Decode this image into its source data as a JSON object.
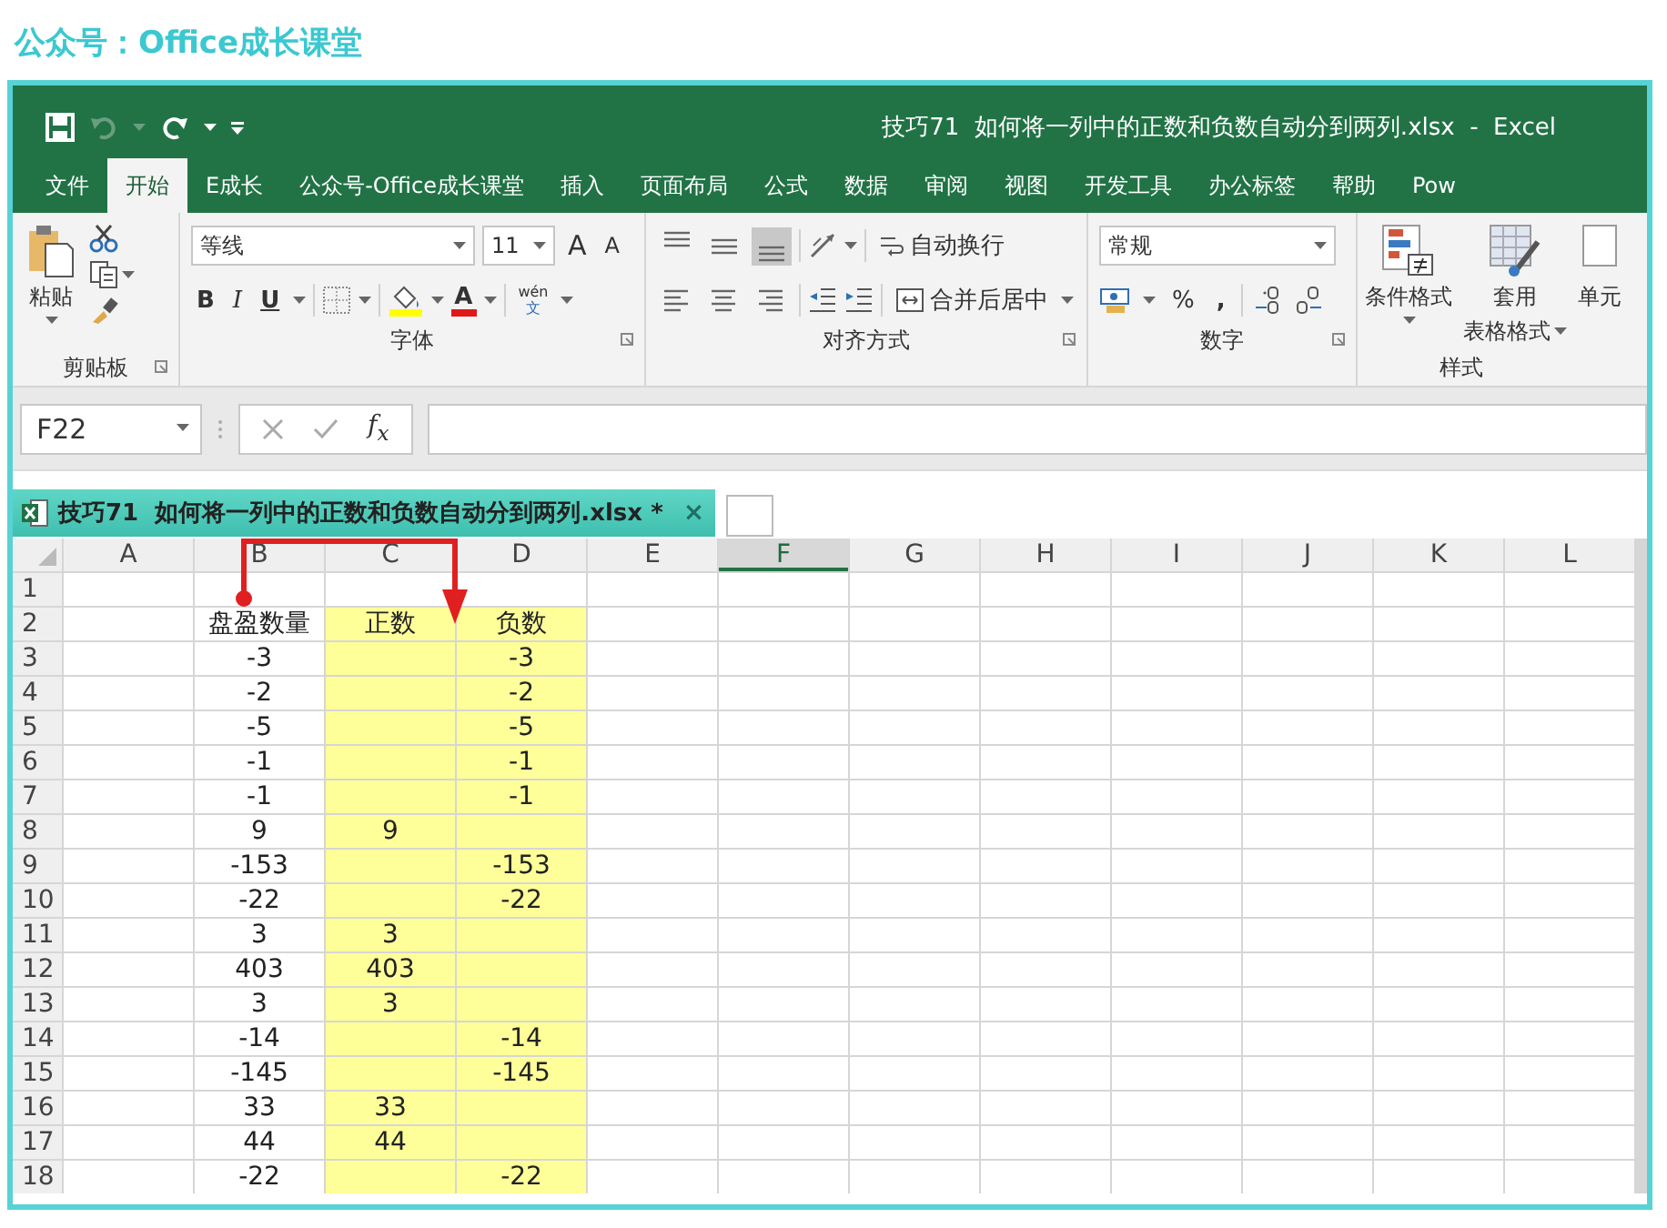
{
  "caption": "公众号：Office成长课堂",
  "window": {
    "title": "技巧71  如何将一列中的正数和负数自动分到两列.xlsx  -  Excel",
    "quick_access": [
      {
        "kind": "save",
        "disabled": false
      },
      {
        "kind": "undo",
        "disabled": true
      },
      {
        "kind": "redo",
        "disabled": false
      },
      {
        "kind": "customize",
        "disabled": false
      }
    ]
  },
  "ribbon_tabs": [
    {
      "label": "文件",
      "selected": false
    },
    {
      "label": "开始",
      "selected": true
    },
    {
      "label": "E成长",
      "selected": false
    },
    {
      "label": "公众号-Office成长课堂",
      "selected": false
    },
    {
      "label": "插入",
      "selected": false
    },
    {
      "label": "页面布局",
      "selected": false
    },
    {
      "label": "公式",
      "selected": false
    },
    {
      "label": "数据",
      "selected": false
    },
    {
      "label": "审阅",
      "selected": false
    },
    {
      "label": "视图",
      "selected": false
    },
    {
      "label": "开发工具",
      "selected": false
    },
    {
      "label": "办公标签",
      "selected": false
    },
    {
      "label": "帮助",
      "selected": false
    },
    {
      "label": "Pow",
      "selected": false
    }
  ],
  "ribbon": {
    "clipboard": {
      "paste": "粘贴",
      "label": "剪贴板"
    },
    "font": {
      "font_name": "等线",
      "font_size": "11",
      "grow": "A",
      "shrink": "A",
      "bold": "B",
      "italic": "I",
      "underline": "U",
      "font_color": "A",
      "phonetic_top": "wén",
      "phonetic_bottom": "文",
      "label": "字体"
    },
    "alignment": {
      "vertical": [
        {
          "kind": "top",
          "selected": false
        },
        {
          "kind": "middle",
          "selected": false
        },
        {
          "kind": "bottom",
          "selected": true
        }
      ],
      "horizontal": [
        {
          "kind": "left",
          "selected": false
        },
        {
          "kind": "center",
          "selected": false
        },
        {
          "kind": "right",
          "selected": false
        }
      ],
      "wrap": "自动换行",
      "merge": "合并后居中",
      "label": "对齐方式"
    },
    "number": {
      "format": "常规",
      "percent": "%",
      "comma": ",",
      "label": "数字"
    },
    "styles": {
      "conditional": "条件格式",
      "table_top": "套用",
      "table_bottom": "表格格式",
      "cell": "单元",
      "label": "样式"
    }
  },
  "formula_bar": {
    "name_box": "F22",
    "function": "f$_{x}$"
  },
  "workbook_tab": {
    "title": "技巧71  如何将一列中的正数和负数自动分到两列.xlsx *",
    "close": "×"
  },
  "sheet": {
    "columns": [
      {
        "label": "A",
        "selected": false
      },
      {
        "label": "B",
        "selected": false
      },
      {
        "label": "C",
        "selected": false
      },
      {
        "label": "D",
        "selected": false
      },
      {
        "label": "E",
        "selected": false
      },
      {
        "label": "F",
        "selected": true
      },
      {
        "label": "G",
        "selected": false
      },
      {
        "label": "H",
        "selected": false
      },
      {
        "label": "I",
        "selected": false
      },
      {
        "label": "J",
        "selected": false
      },
      {
        "label": "K",
        "selected": false
      },
      {
        "label": "L",
        "selected": false
      }
    ],
    "rows": [
      {
        "number": "1",
        "cells": [
          {},
          {},
          {},
          {}
        ]
      },
      {
        "number": "2",
        "cells": [
          {},
          {
            "text": "盘盈数量"
          },
          {
            "text": "正数",
            "highlighted": true
          },
          {
            "text": "负数",
            "highlighted": true
          }
        ]
      },
      {
        "number": "3",
        "cells": [
          {},
          {
            "text": "-3"
          },
          {
            "highlighted": true
          },
          {
            "text": "-3",
            "highlighted": true
          }
        ]
      },
      {
        "number": "4",
        "cells": [
          {},
          {
            "text": "-2"
          },
          {
            "highlighted": true
          },
          {
            "text": "-2",
            "highlighted": true
          }
        ]
      },
      {
        "number": "5",
        "cells": [
          {},
          {
            "text": "-5"
          },
          {
            "highlighted": true
          },
          {
            "text": "-5",
            "highlighted": true
          }
        ]
      },
      {
        "number": "6",
        "cells": [
          {},
          {
            "text": "-1"
          },
          {
            "highlighted": true
          },
          {
            "text": "-1",
            "highlighted": true
          }
        ]
      },
      {
        "number": "7",
        "cells": [
          {},
          {
            "text": "-1"
          },
          {
            "highlighted": true
          },
          {
            "text": "-1",
            "highlighted": true
          }
        ]
      },
      {
        "number": "8",
        "cells": [
          {},
          {
            "text": "9"
          },
          {
            "text": "9",
            "highlighted": true
          },
          {
            "highlighted": true
          }
        ]
      },
      {
        "number": "9",
        "cells": [
          {},
          {
            "text": "-153"
          },
          {
            "highlighted": true
          },
          {
            "text": "-153",
            "highlighted": true
          }
        ]
      },
      {
        "number": "10",
        "cells": [
          {},
          {
            "text": "-22"
          },
          {
            "highlighted": true
          },
          {
            "text": "-22",
            "highlighted": true
          }
        ]
      },
      {
        "number": "11",
        "cells": [
          {},
          {
            "text": "3"
          },
          {
            "text": "3",
            "highlighted": true
          },
          {
            "highlighted": true
          }
        ]
      },
      {
        "number": "12",
        "cells": [
          {},
          {
            "text": "403"
          },
          {
            "text": "403",
            "highlighted": true
          },
          {
            "highlighted": true
          }
        ]
      },
      {
        "number": "13",
        "cells": [
          {},
          {
            "text": "3"
          },
          {
            "text": "3",
            "highlighted": true
          },
          {
            "highlighted": true
          }
        ]
      },
      {
        "number": "14",
        "cells": [
          {},
          {
            "text": "-14"
          },
          {
            "highlighted": true
          },
          {
            "text": "-14",
            "highlighted": true
          }
        ]
      },
      {
        "number": "15",
        "cells": [
          {},
          {
            "text": "-145"
          },
          {
            "highlighted": true
          },
          {
            "text": "-145",
            "highlighted": true
          }
        ]
      },
      {
        "number": "16",
        "cells": [
          {},
          {
            "text": "33"
          },
          {
            "text": "33",
            "highlighted": true
          },
          {
            "highlighted": true
          }
        ]
      },
      {
        "number": "17",
        "cells": [
          {},
          {
            "text": "44"
          },
          {
            "text": "44",
            "highlighted": true
          },
          {
            "highlighted": true
          }
        ]
      },
      {
        "number": "18",
        "cells": [
          {},
          {
            "text": "-22"
          },
          {
            "highlighted": true
          },
          {
            "text": "-22",
            "highlighted": true
          }
        ]
      }
    ]
  }
}
